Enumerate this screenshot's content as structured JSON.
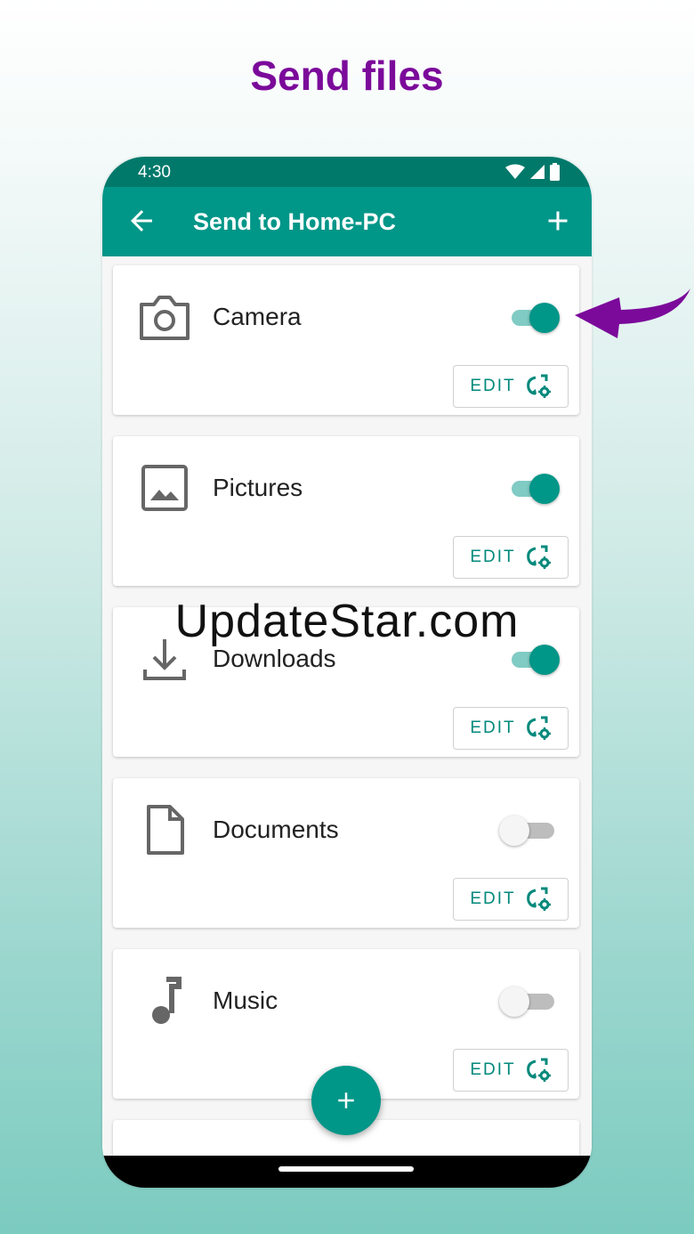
{
  "headline": "Send files",
  "status": {
    "time": "4:30"
  },
  "appbar": {
    "title": "Send to Home-PC"
  },
  "folders": [
    {
      "name": "Camera",
      "icon": "camera-icon",
      "enabled": true,
      "edit_label": "EDIT"
    },
    {
      "name": "Pictures",
      "icon": "image-icon",
      "enabled": true,
      "edit_label": "EDIT"
    },
    {
      "name": "Downloads",
      "icon": "download-icon",
      "enabled": true,
      "edit_label": "EDIT"
    },
    {
      "name": "Documents",
      "icon": "document-icon",
      "enabled": false,
      "edit_label": "EDIT"
    },
    {
      "name": "Music",
      "icon": "music-note-icon",
      "enabled": false,
      "edit_label": "EDIT"
    }
  ],
  "watermark": "UpdateStar.com",
  "colors": {
    "primary": "#009688",
    "primary_dark": "#00796b",
    "headline": "#7b0a9a",
    "arrow": "#7b0a9a"
  }
}
